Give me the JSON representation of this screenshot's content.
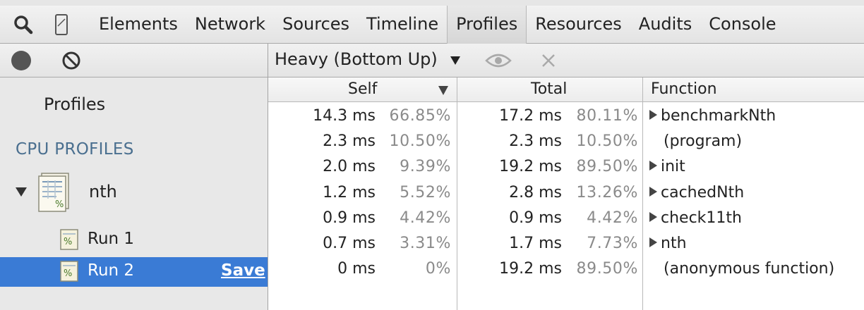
{
  "tabs": [
    "Elements",
    "Network",
    "Sources",
    "Timeline",
    "Profiles",
    "Resources",
    "Audits",
    "Console"
  ],
  "active_tab": "Profiles",
  "sidebar": {
    "heading": "Profiles",
    "section": "CPU PROFILES",
    "group": {
      "label": "nth",
      "expanded": true
    },
    "runs": [
      {
        "label": "Run 1",
        "selected": false
      },
      {
        "label": "Run 2",
        "selected": true,
        "action": "Save"
      }
    ]
  },
  "toolbar": {
    "view_mode": "Heavy (Bottom Up)"
  },
  "grid": {
    "columns": {
      "self": "Self",
      "total": "Total",
      "function": "Function"
    },
    "rows": [
      {
        "self_ms": "14.3 ms",
        "self_pct": "66.85%",
        "total_ms": "17.2 ms",
        "total_pct": "80.11%",
        "function": "benchmarkNth",
        "expandable": true
      },
      {
        "self_ms": "2.3 ms",
        "self_pct": "10.50%",
        "total_ms": "2.3 ms",
        "total_pct": "10.50%",
        "function": "(program)",
        "expandable": false
      },
      {
        "self_ms": "2.0 ms",
        "self_pct": "9.39%",
        "total_ms": "19.2 ms",
        "total_pct": "89.50%",
        "function": "init",
        "expandable": true
      },
      {
        "self_ms": "1.2 ms",
        "self_pct": "5.52%",
        "total_ms": "2.8 ms",
        "total_pct": "13.26%",
        "function": "cachedNth",
        "expandable": true
      },
      {
        "self_ms": "0.9 ms",
        "self_pct": "4.42%",
        "total_ms": "0.9 ms",
        "total_pct": "4.42%",
        "function": "check11th",
        "expandable": true
      },
      {
        "self_ms": "0.7 ms",
        "self_pct": "3.31%",
        "total_ms": "1.7 ms",
        "total_pct": "7.73%",
        "function": "nth",
        "expandable": true
      },
      {
        "self_ms": "0 ms",
        "self_pct": "0%",
        "total_ms": "19.2 ms",
        "total_pct": "89.50%",
        "function": "(anonymous function)",
        "expandable": false
      }
    ]
  },
  "colors": {
    "selection": "#3a7bd5",
    "section_heading": "#4a6f8f",
    "percent_text": "#8a8a8a"
  },
  "icons": [
    "search-icon",
    "device-mode-icon",
    "record-icon",
    "clear-icon",
    "eye-icon",
    "close-icon",
    "profile-group-icon",
    "profile-run-icon",
    "sort-descending-icon",
    "expand-arrow-icon"
  ]
}
